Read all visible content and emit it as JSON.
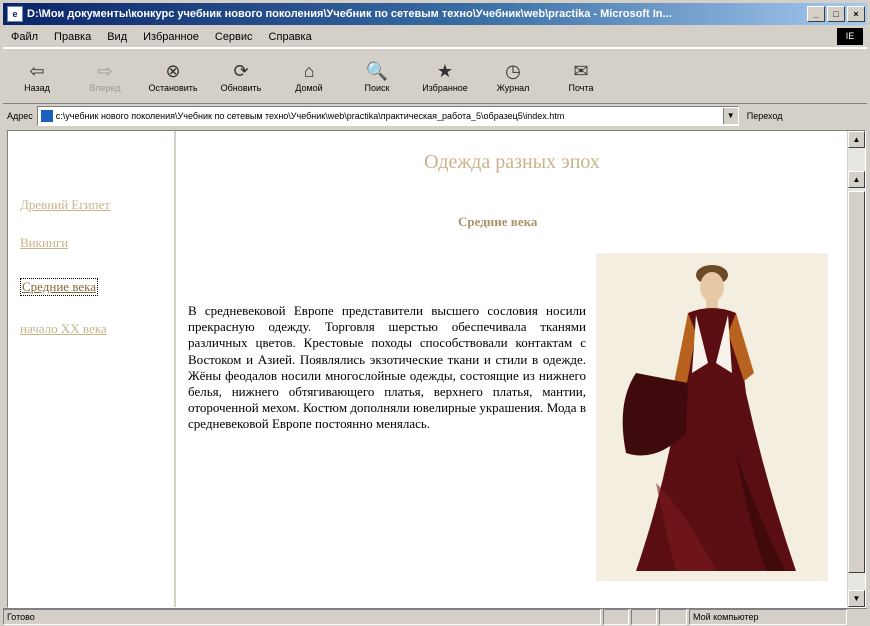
{
  "window": {
    "title": "D:\\Мои документы\\конкурс учебник нового поколения\\Учебник по сетевым техно\\Учебник\\web\\practika - Microsoft In...",
    "buttons": [
      "_",
      "□",
      "×"
    ],
    "ie_logo": "IE"
  },
  "menu": [
    "Файл",
    "Правка",
    "Вид",
    "Избранное",
    "Сервис",
    "Справка"
  ],
  "toolbar": [
    {
      "label": "Назад",
      "icon": "back-arrow-icon",
      "glyph": "⇦",
      "enabled": true
    },
    {
      "label": "Вперед",
      "icon": "forward-arrow-icon",
      "glyph": "⇨",
      "enabled": false
    },
    {
      "label": "Остановить",
      "icon": "stop-icon",
      "glyph": "⊗",
      "enabled": true
    },
    {
      "label": "Обновить",
      "icon": "refresh-icon",
      "glyph": "⟳",
      "enabled": true
    },
    {
      "label": "Домой",
      "icon": "home-icon",
      "glyph": "⌂",
      "enabled": true
    },
    {
      "label": "Поиск",
      "icon": "search-icon",
      "glyph": "🔍",
      "enabled": true
    },
    {
      "label": "Избранное",
      "icon": "favorites-icon",
      "glyph": "★",
      "enabled": true
    },
    {
      "label": "Журнал",
      "icon": "history-icon",
      "glyph": "◷",
      "enabled": true
    },
    {
      "label": "Почта",
      "icon": "mail-icon",
      "glyph": "✉",
      "enabled": true
    }
  ],
  "address": {
    "label": "Адрес",
    "url": "c:\\учебник нового поколения\\Учебник по сетевым техно\\Учебник\\web\\practika\\практическая_работа_5\\образец5\\index.htm",
    "go_label": "Переход"
  },
  "sidebar": {
    "links": [
      {
        "label": "Древний Египет",
        "active": false
      },
      {
        "label": "Викинги",
        "active": false
      },
      {
        "label": "Средние века",
        "active": true
      },
      {
        "label": "начало XX века",
        "active": false
      }
    ]
  },
  "content": {
    "title": "Одежда разных эпох",
    "subtitle": "Средние века",
    "body": "В средневековой Европе представители высшего сословия носили прекрасную одежду. Торговля шерстью обеспечивала тканями различных цветов. Крестовые походы способствовали контактам с Востоком и Азией. Появлялись экзотические ткани и стили в одежде. Жёны феодалов носили многослойные одежды, состоящие из нижнего белья, нижнего обтягивающего платья, верхнего платья, мантии, отороченной мехом. Костюм дополняли ювелирные украшения. Мода в средневековой Европе постоянно менялась."
  },
  "status": {
    "left": "Готово",
    "right": "Мой компьютер"
  },
  "colors": {
    "link": "#c9b48a",
    "title": "#c9b48a",
    "subtitle": "#a8946a",
    "titlebar_start": "#0a246a",
    "dress": "#5a0e12"
  }
}
